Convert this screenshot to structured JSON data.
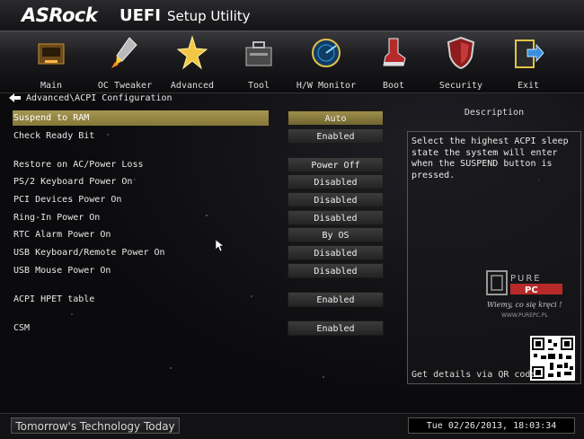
{
  "header": {
    "brand": "ASRock",
    "uefi": "UEFI",
    "setup": "Setup Utility"
  },
  "nav": {
    "items": [
      {
        "label": "Main",
        "icon": "main-icon"
      },
      {
        "label": "OC Tweaker",
        "icon": "rocket-icon"
      },
      {
        "label": "Advanced",
        "icon": "star-icon"
      },
      {
        "label": "Tool",
        "icon": "toolbox-icon"
      },
      {
        "label": "H/W Monitor",
        "icon": "radar-icon"
      },
      {
        "label": "Boot",
        "icon": "boot-icon"
      },
      {
        "label": "Security",
        "icon": "shield-icon"
      },
      {
        "label": "Exit",
        "icon": "exit-icon"
      }
    ],
    "active": "Advanced"
  },
  "breadcrumb": "Advanced\\ACPI Configuration",
  "settings": [
    {
      "label": "Suspend to RAM",
      "value": "Auto",
      "selected": true
    },
    {
      "label": "Check Ready Bit",
      "value": "Enabled"
    },
    {
      "label": "Restore on AC/Power Loss",
      "value": "Power Off"
    },
    {
      "label": "PS/2 Keyboard Power On",
      "value": "Disabled"
    },
    {
      "label": "PCI Devices Power On",
      "value": "Disabled"
    },
    {
      "label": "Ring-In Power On",
      "value": "Disabled"
    },
    {
      "label": "RTC Alarm Power On",
      "value": "By OS"
    },
    {
      "label": "USB Keyboard/Remote Power On",
      "value": "Disabled"
    },
    {
      "label": "USB Mouse Power On",
      "value": "Disabled"
    },
    {
      "label": "ACPI HPET table",
      "value": "Enabled"
    },
    {
      "label": "CSM",
      "value": "Enabled"
    }
  ],
  "description": {
    "title": "Description",
    "text": "Select the highest ACPI sleep state the system will enter when the SUSPEND button is pressed.",
    "qr_text": "Get details via QR code"
  },
  "watermark": {
    "brand": "PURE PC",
    "slogan": "Wiemy, co się kręci !",
    "url": "WWW.PUREPC.PL"
  },
  "footer": {
    "tagline": "Tomorrow's Technology Today",
    "datetime": "Tue 02/26/2013, 18:03:34"
  },
  "colors": {
    "selected": "#a0904d",
    "background": "#0a0a0c"
  }
}
